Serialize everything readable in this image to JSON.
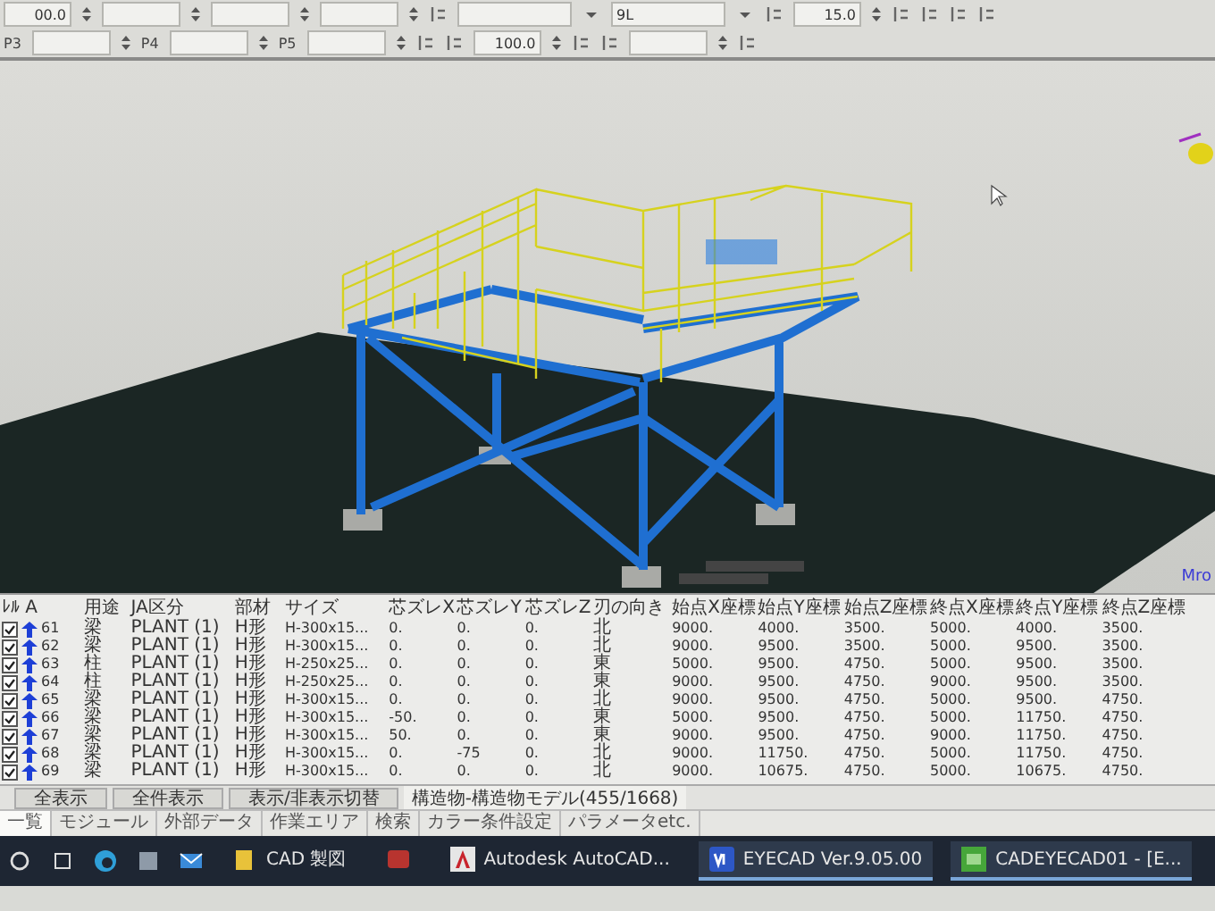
{
  "toolbar": {
    "rows": [
      [
        {
          "kind": "field",
          "value": "00.0"
        },
        {
          "kind": "field"
        },
        {
          "kind": "field"
        },
        {
          "kind": "field"
        },
        {
          "kind": "icon"
        },
        {
          "kind": "select"
        },
        {
          "kind": "select",
          "value": "9L"
        },
        {
          "kind": "icon"
        },
        {
          "kind": "field",
          "value": "15.0"
        },
        {
          "kind": "icon"
        },
        {
          "kind": "icon"
        },
        {
          "kind": "icon"
        },
        {
          "kind": "icon"
        }
      ],
      [
        {
          "kind": "label",
          "text": "P3"
        },
        {
          "kind": "field"
        },
        {
          "kind": "label",
          "text": "P4"
        },
        {
          "kind": "field"
        },
        {
          "kind": "label",
          "text": "P5"
        },
        {
          "kind": "field"
        },
        {
          "kind": "icon"
        },
        {
          "kind": "icon"
        },
        {
          "kind": "field",
          "value": "100.0"
        },
        {
          "kind": "icon"
        },
        {
          "kind": "icon"
        },
        {
          "kind": "field"
        },
        {
          "kind": "icon"
        }
      ]
    ]
  },
  "viewport": {
    "corner_label": "Mro"
  },
  "table": {
    "columns": [
      "ﾚﾙ A",
      "用途",
      "JA区分",
      "部材",
      "サイズ",
      "芯ズレX",
      "芯ズレY",
      "芯ズレZ",
      "刃の向き",
      "始点X座標",
      "始点Y座標",
      "始点Z座標",
      "終点X座標",
      "終点Y座標",
      "終点Z座標"
    ],
    "rows": [
      {
        "checked": true,
        "cells": [
          "61",
          "梁",
          "PLANT (1)",
          "H形",
          "H-300x15...",
          "0.",
          "0.",
          "0.",
          "北",
          "9000.",
          "4000.",
          "3500.",
          "5000.",
          "4000.",
          "3500."
        ]
      },
      {
        "checked": true,
        "cells": [
          "62",
          "梁",
          "PLANT (1)",
          "H形",
          "H-300x15...",
          "0.",
          "0.",
          "0.",
          "北",
          "9000.",
          "9500.",
          "3500.",
          "5000.",
          "9500.",
          "3500."
        ]
      },
      {
        "checked": true,
        "cells": [
          "63",
          "柱",
          "PLANT (1)",
          "H形",
          "H-250x25...",
          "0.",
          "0.",
          "0.",
          "東",
          "5000.",
          "9500.",
          "4750.",
          "5000.",
          "9500.",
          "3500."
        ]
      },
      {
        "checked": true,
        "cells": [
          "64",
          "柱",
          "PLANT (1)",
          "H形",
          "H-250x25...",
          "0.",
          "0.",
          "0.",
          "東",
          "9000.",
          "9500.",
          "4750.",
          "9000.",
          "9500.",
          "3500."
        ]
      },
      {
        "checked": true,
        "cells": [
          "65",
          "梁",
          "PLANT (1)",
          "H形",
          "H-300x15...",
          "0.",
          "0.",
          "0.",
          "北",
          "9000.",
          "9500.",
          "4750.",
          "5000.",
          "9500.",
          "4750."
        ]
      },
      {
        "checked": true,
        "cells": [
          "66",
          "梁",
          "PLANT (1)",
          "H形",
          "H-300x15...",
          "-50.",
          "0.",
          "0.",
          "東",
          "5000.",
          "9500.",
          "4750.",
          "5000.",
          "11750.",
          "4750."
        ]
      },
      {
        "checked": true,
        "cells": [
          "67",
          "梁",
          "PLANT (1)",
          "H形",
          "H-300x15...",
          "50.",
          "0.",
          "0.",
          "東",
          "9000.",
          "9500.",
          "4750.",
          "9000.",
          "11750.",
          "4750."
        ]
      },
      {
        "checked": true,
        "cells": [
          "68",
          "梁",
          "PLANT (1)",
          "H形",
          "H-300x15...",
          "0.",
          "-75",
          "0.",
          "北",
          "9000.",
          "11750.",
          "4750.",
          "5000.",
          "11750.",
          "4750."
        ]
      },
      {
        "checked": true,
        "cells": [
          "69",
          "梁",
          "PLANT (1)",
          "H形",
          "H-300x15...",
          "0.",
          "0.",
          "0.",
          "北",
          "9000.",
          "10675.",
          "4750.",
          "5000.",
          "10675.",
          "4750."
        ]
      }
    ]
  },
  "action_bar": {
    "buttons": [
      "全表示",
      "全件表示",
      "表示/非表示切替"
    ],
    "status": "構造物-構造物モデル(455/1668)"
  },
  "bottom_tabs": [
    {
      "label": "一覧",
      "selected": true
    },
    {
      "label": "モジュール",
      "selected": false
    },
    {
      "label": "外部データ",
      "selected": false
    },
    {
      "label": "作業エリア",
      "selected": false
    },
    {
      "label": "検索",
      "selected": false
    },
    {
      "label": "カラー条件設定",
      "selected": false
    },
    {
      "label": "パラメータetc.",
      "selected": false
    }
  ],
  "taskbar": {
    "apps": [
      {
        "label": "CAD 製図",
        "kind": "folder",
        "selected": false
      },
      {
        "kind": "access",
        "selected": false
      },
      {
        "label": "Autodesk AutoCAD...",
        "kind": "autocad",
        "selected": false
      },
      {
        "label": "EYECAD Ver.9.05.00",
        "kind": "eyecad",
        "selected": true
      },
      {
        "label": "CADEYECAD01 - [E...",
        "kind": "project",
        "selected": true
      }
    ]
  }
}
